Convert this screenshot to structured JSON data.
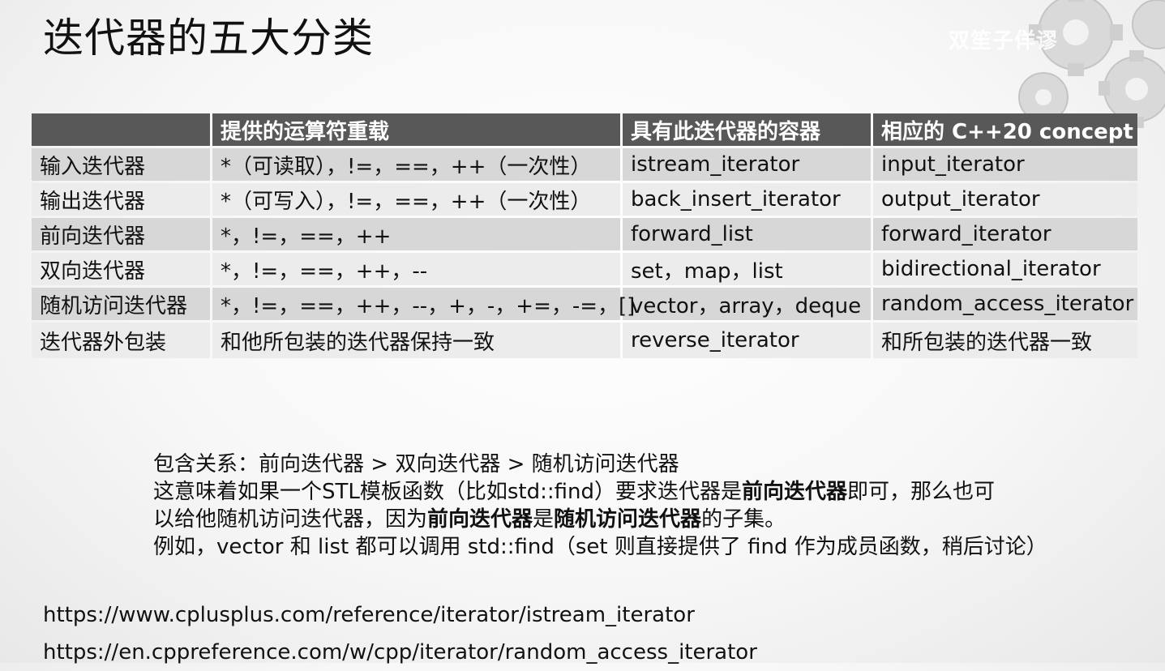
{
  "slide": {
    "title": "迭代器的五大分类",
    "watermark": "双笙子佯谬"
  },
  "table": {
    "headers": [
      "",
      "提供的运算符重载",
      "具有此迭代器的容器",
      "相应的 C++20 concept"
    ],
    "rows": [
      [
        "输入迭代器",
        "*（可读取），!=，==，++（一次性）",
        "istream_iterator",
        "input_iterator"
      ],
      [
        "输出迭代器",
        "*（可写入），!=，==，++（一次性）",
        "back_insert_iterator",
        "output_iterator"
      ],
      [
        "前向迭代器",
        "*，!=，==，++",
        "forward_list",
        "forward_iterator"
      ],
      [
        "双向迭代器",
        "*，!=，==，++，--",
        "set，map，list",
        "bidirectional_iterator"
      ],
      [
        "随机访问迭代器",
        "*，!=，==，++，--，+，-，+=，-=，[]",
        "vector，array，deque",
        "random_access_iterator"
      ],
      [
        "迭代器外包装",
        "和他所包装的迭代器保持一致",
        "reverse_iterator",
        "和所包装的迭代器一致"
      ]
    ]
  },
  "notes": {
    "line1": "包含关系：前向迭代器 > 双向迭代器 > 随机访问迭代器",
    "line2_a": "这意味着如果一个STL模板函数（比如std::find）要求迭代器是",
    "line2_b": "前向迭代器",
    "line2_c": "即可，那么也可",
    "line3_a": "以给他随机访问迭代器，因为",
    "line3_b": "前向迭代器",
    "line3_c": "是",
    "line3_d": "随机访问迭代器",
    "line3_e": "的子集。",
    "line4": "例如，vector 和 list 都可以调用 std::find（set 则直接提供了 find 作为成员函数，稍后讨论）"
  },
  "links": [
    "https://www.cplusplus.com/reference/iterator/istream_iterator",
    "https://en.cppreference.com/w/cpp/iterator/random_access_iterator"
  ]
}
